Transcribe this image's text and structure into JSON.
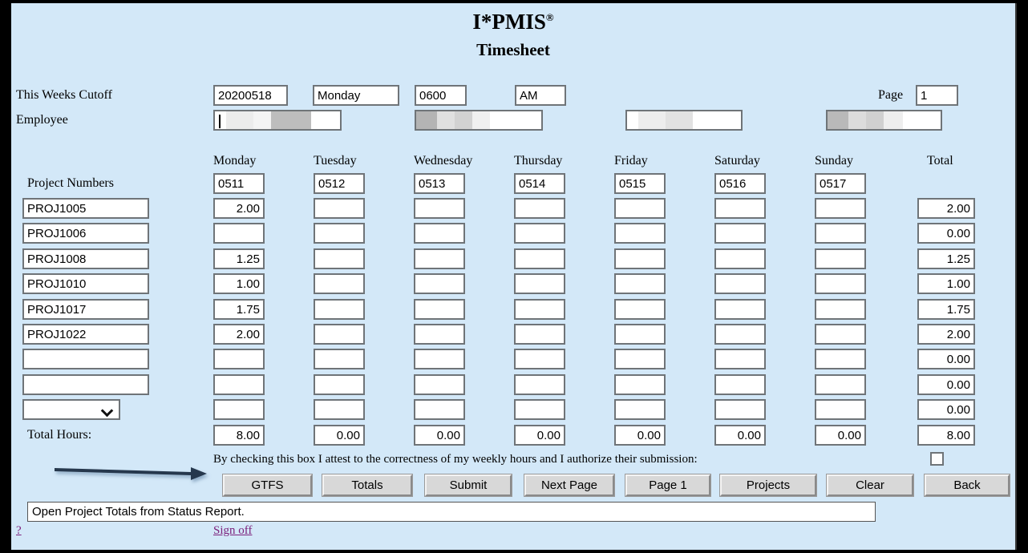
{
  "header": {
    "title": "I*PMIS",
    "title_sup": "®",
    "subtitle": "Timesheet"
  },
  "cutoff": {
    "label": "This Weeks Cutoff",
    "date": "20200518",
    "day": "Monday",
    "time": "0600",
    "meridiem": "AM"
  },
  "page_field": {
    "label": "Page",
    "value": "1"
  },
  "employee": {
    "label": "Employee",
    "field1": "",
    "field2": "",
    "field3": "",
    "field4": ""
  },
  "grid": {
    "project_numbers_label": "Project Numbers",
    "total_hours_label": "Total Hours:",
    "day_headers": [
      "Monday",
      "Tuesday",
      "Wednesday",
      "Thursday",
      "Friday",
      "Saturday",
      "Sunday"
    ],
    "total_header": "Total",
    "day_dates": [
      "0511",
      "0512",
      "0513",
      "0514",
      "0515",
      "0516",
      "0517"
    ],
    "rows": [
      {
        "project": "PROJ1005",
        "hours": [
          "2.00",
          "",
          "",
          "",
          "",
          "",
          ""
        ],
        "total": "2.00"
      },
      {
        "project": "PROJ1006",
        "hours": [
          "",
          "",
          "",
          "",
          "",
          "",
          ""
        ],
        "total": "0.00"
      },
      {
        "project": "PROJ1008",
        "hours": [
          "1.25",
          "",
          "",
          "",
          "",
          "",
          ""
        ],
        "total": "1.25"
      },
      {
        "project": "PROJ1010",
        "hours": [
          "1.00",
          "",
          "",
          "",
          "",
          "",
          ""
        ],
        "total": "1.00"
      },
      {
        "project": "PROJ1017",
        "hours": [
          "1.75",
          "",
          "",
          "",
          "",
          "",
          ""
        ],
        "total": "1.75"
      },
      {
        "project": "PROJ1022",
        "hours": [
          "2.00",
          "",
          "",
          "",
          "",
          "",
          ""
        ],
        "total": "2.00"
      },
      {
        "project": "",
        "hours": [
          "",
          "",
          "",
          "",
          "",
          "",
          ""
        ],
        "total": "0.00"
      },
      {
        "project": "",
        "hours": [
          "",
          "",
          "",
          "",
          "",
          "",
          ""
        ],
        "total": "0.00"
      },
      {
        "project": "",
        "hours": [
          "",
          "",
          "",
          "",
          "",
          "",
          ""
        ],
        "total": "0.00"
      }
    ],
    "project_select_value": "",
    "day_totals": [
      "8.00",
      "0.00",
      "0.00",
      "0.00",
      "0.00",
      "0.00",
      "0.00"
    ],
    "grand_total": "8.00"
  },
  "attestation": {
    "text": "By checking this box I attest to the correctness of my weekly hours and I authorize their submission:",
    "checked": false
  },
  "buttons": [
    {
      "label": "GTFS"
    },
    {
      "label": "Totals"
    },
    {
      "label": "Submit"
    },
    {
      "label": "Next Page"
    },
    {
      "label": "Page 1"
    },
    {
      "label": "Projects"
    },
    {
      "label": "Clear"
    },
    {
      "label": "Back"
    }
  ],
  "status": {
    "message": "Open Project Totals from Status Report."
  },
  "footer": {
    "help_link": "?",
    "signoff_link": "Sign off"
  },
  "colors": {
    "background": "#d3e8f8",
    "link": "#7b1f7b",
    "arrow": "#27374d",
    "button_face": "#d8d8d8"
  }
}
